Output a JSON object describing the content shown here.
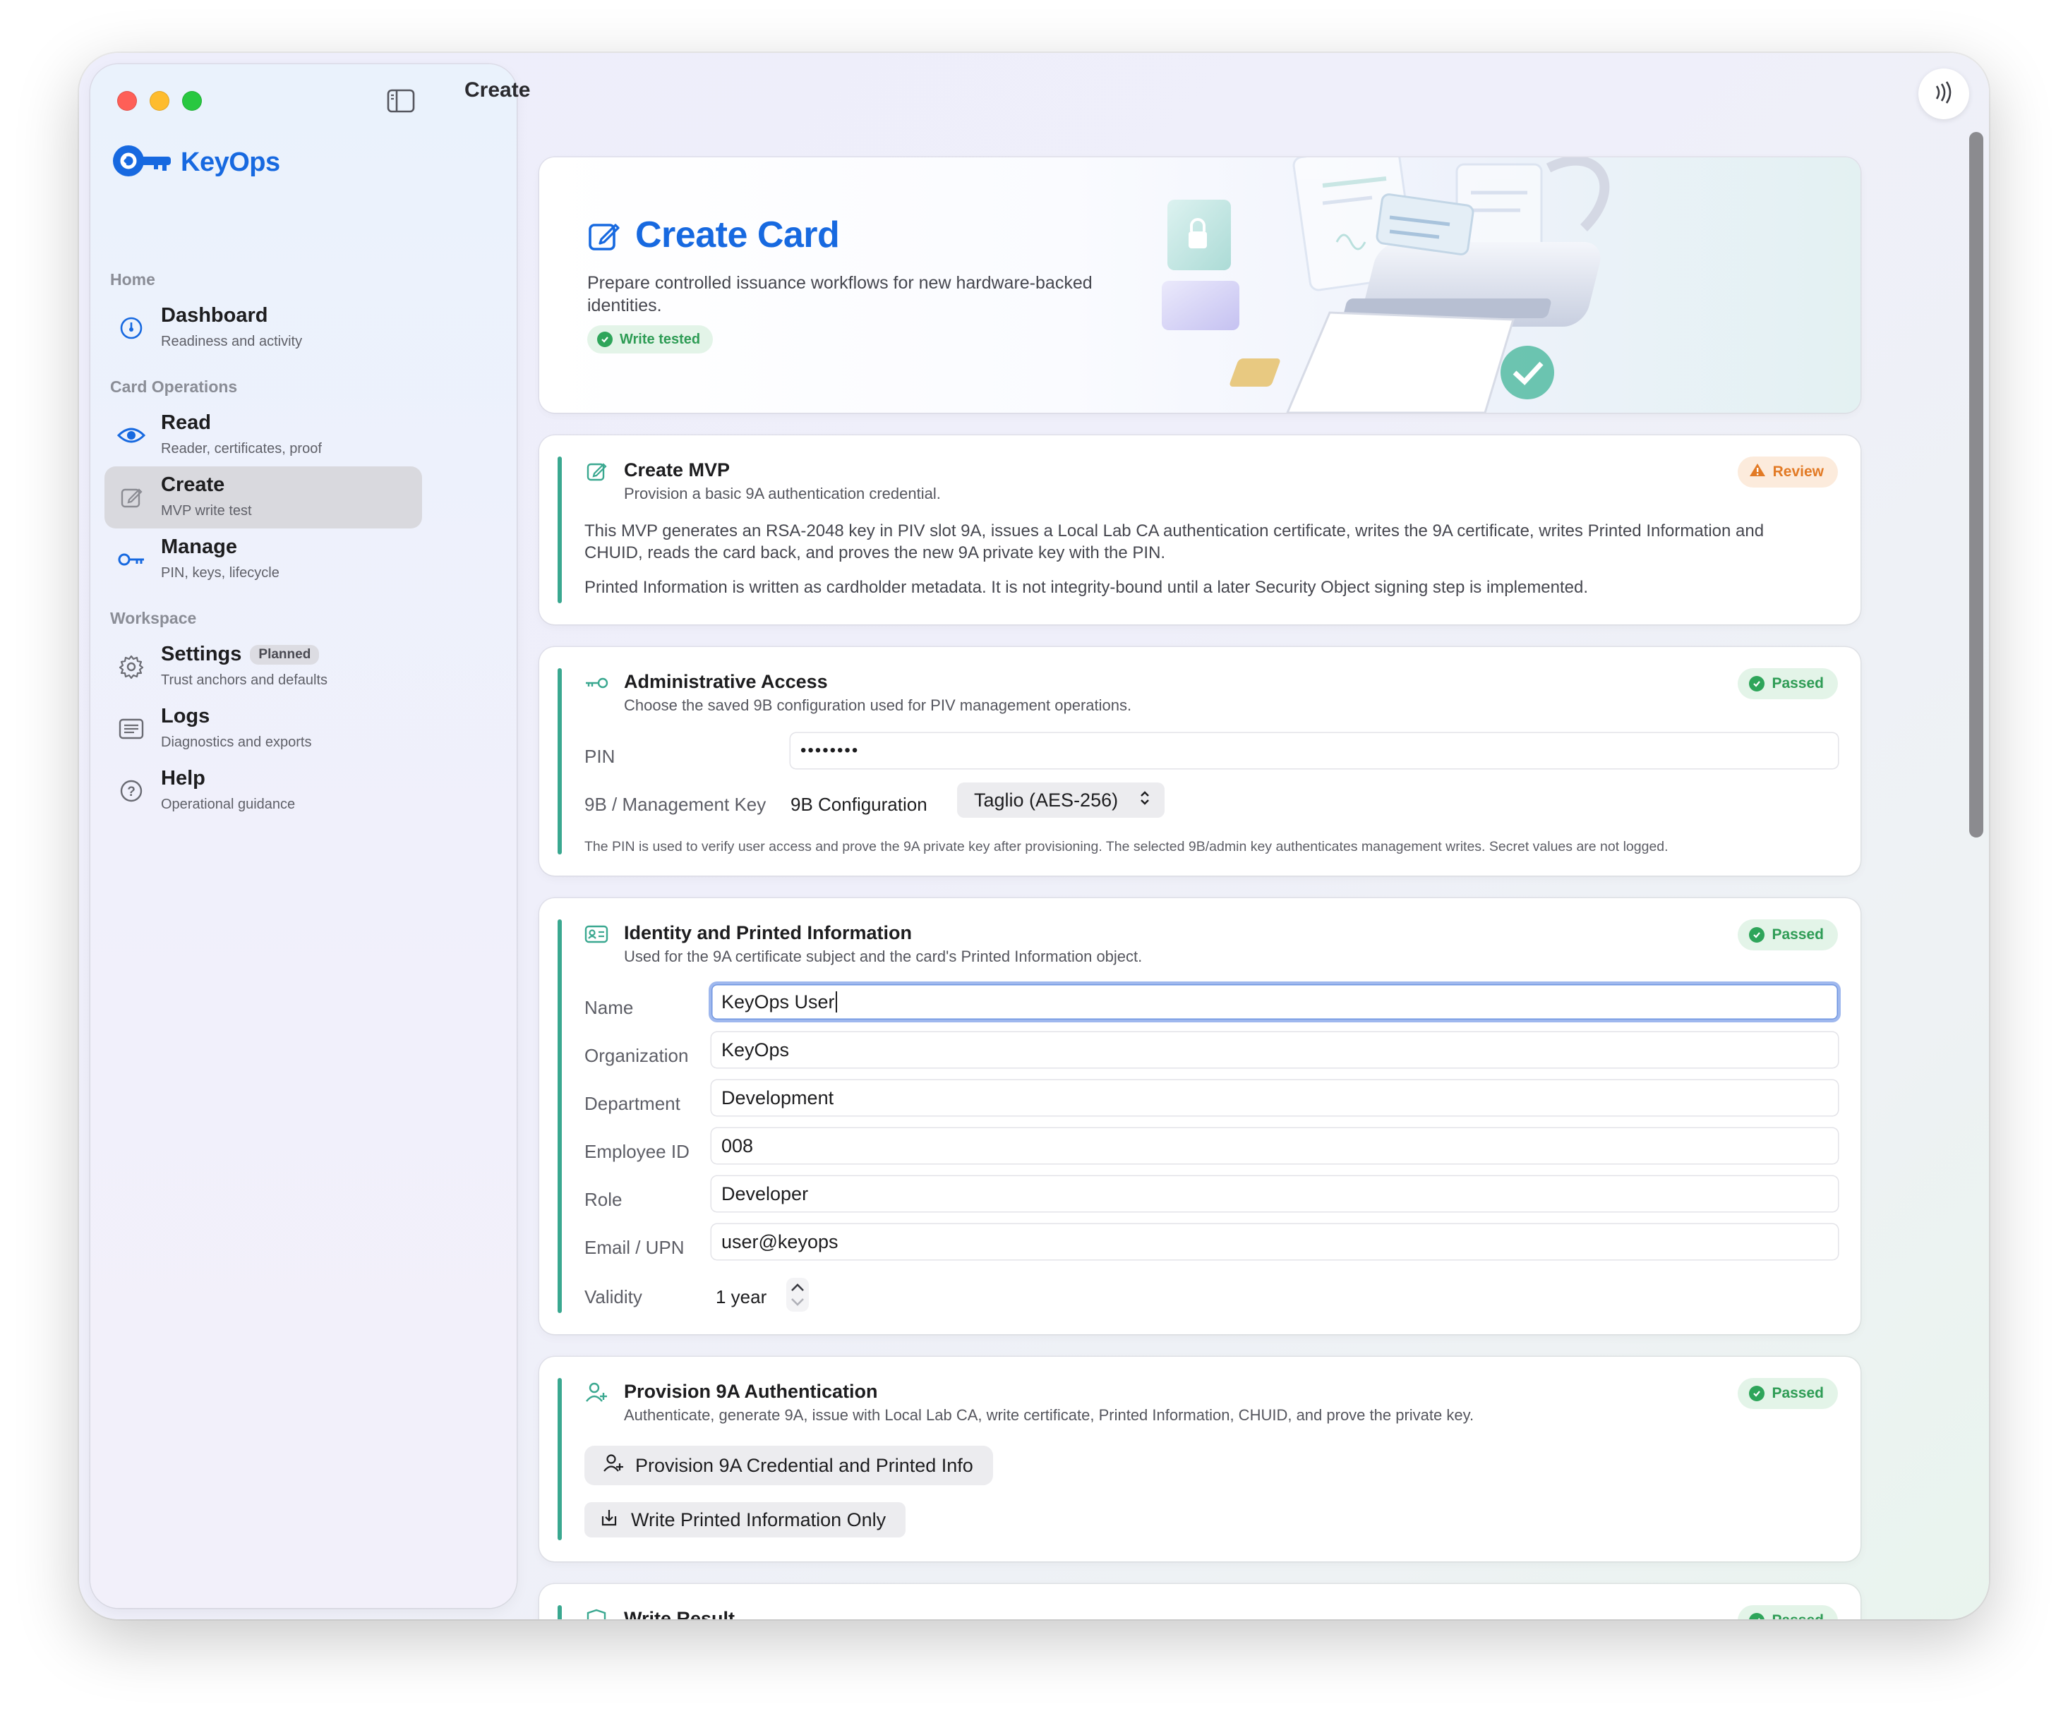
{
  "window": {
    "title": "Create"
  },
  "sidebar": {
    "brand": "KeyOps",
    "sections": {
      "home": "Home",
      "card_operations": "Card Operations",
      "workspace": "Workspace"
    },
    "items": [
      {
        "title": "Dashboard",
        "subtitle": "Readiness and activity"
      },
      {
        "title": "Read",
        "subtitle": "Reader, certificates, proof"
      },
      {
        "title": "Create",
        "subtitle": "MVP write test"
      },
      {
        "title": "Manage",
        "subtitle": "PIN, keys, lifecycle"
      },
      {
        "title": "Settings",
        "subtitle": "Trust anchors and defaults",
        "badge": "Planned"
      },
      {
        "title": "Logs",
        "subtitle": "Diagnostics and exports"
      },
      {
        "title": "Help",
        "subtitle": "Operational guidance"
      }
    ]
  },
  "hero": {
    "title": "Create Card",
    "subtitle": "Prepare controlled issuance workflows for new hardware-backed identities.",
    "badge": "Write tested"
  },
  "mvp": {
    "title": "Create MVP",
    "subtitle": "Provision a basic 9A authentication credential.",
    "status": "Review",
    "para1": "This MVP generates an RSA-2048 key in PIV slot 9A, issues a Local Lab CA authentication certificate, writes the 9A certificate, writes Printed Information and CHUID, reads the card back, and proves the new 9A private key with the PIN.",
    "para2": "Printed Information is written as cardholder metadata. It is not integrity-bound until a later Security Object signing step is implemented."
  },
  "admin": {
    "title": "Administrative Access",
    "subtitle": "Choose the saved 9B configuration used for PIV management operations.",
    "status": "Passed",
    "pin_label": "PIN",
    "pin_value": "••••••••",
    "mgmt_label": "9B / Management Key",
    "config_label": "9B Configuration",
    "config_value": "Taglio (AES-256)",
    "note": "The PIN is used to verify user access and prove the 9A private key after provisioning. The selected 9B/admin key authenticates management writes. Secret values are not logged."
  },
  "identity": {
    "title": "Identity and Printed Information",
    "subtitle": "Used for the 9A certificate subject and the card's Printed Information object.",
    "status": "Passed",
    "fields": [
      {
        "label": "Name",
        "value": "KeyOps User"
      },
      {
        "label": "Organization",
        "value": "KeyOps"
      },
      {
        "label": "Department",
        "value": "Development"
      },
      {
        "label": "Employee ID",
        "value": "008"
      },
      {
        "label": "Role",
        "value": "Developer"
      },
      {
        "label": "Email / UPN",
        "value": "user@keyops"
      }
    ],
    "validity_label": "Validity",
    "validity_value": "1 year"
  },
  "provision": {
    "title": "Provision 9A Authentication",
    "subtitle": "Authenticate, generate 9A, issue with Local Lab CA, write certificate, Printed Information, CHUID, and prove the private key.",
    "status": "Passed",
    "button_primary": "Provision 9A Credential and Printed Info",
    "button_secondary": "Write Printed Information Only"
  },
  "write_result": {
    "title": "Write Result",
    "status": "Passed"
  },
  "colors": {
    "accent_blue": "#1769e0",
    "accent_teal": "#3aa890",
    "passed_green": "#2e9c55",
    "review_orange": "#e27a25"
  }
}
